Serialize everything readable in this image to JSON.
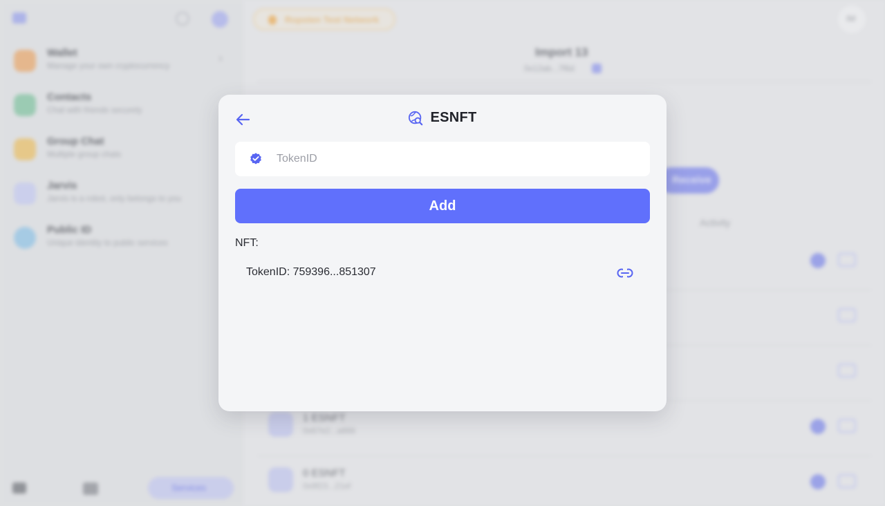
{
  "background": {
    "sidebar": {
      "items": [
        {
          "title": "Wallet",
          "subtitle": "Manage your own cryptocurrency",
          "color": "#f0a866"
        },
        {
          "title": "Contacts",
          "subtitle": "Chat with friends securely",
          "color": "#7fc6a0"
        },
        {
          "title": "Group Chat",
          "subtitle": "Multiple group chats",
          "color": "#f1c260"
        },
        {
          "title": "Jarvis",
          "subtitle": "Jarvis is a robot, only belongs to you",
          "color": "#c8cdf7"
        },
        {
          "title": "Public ID",
          "subtitle": "Unique identity to public services",
          "color": "#8fc6ec"
        }
      ],
      "bottom_button": "Services"
    },
    "network_badge": "Ropsten Test Network",
    "avatar_initials": "IM",
    "account": {
      "title": "Import 13",
      "address": "0x12ab...7f6d"
    },
    "receive_label": "Receive",
    "activity_label": "Activity",
    "rows": [
      {
        "name": "1 ESNFT",
        "sub": "0x67e2...a866"
      },
      {
        "name": "0 ESNFT",
        "sub": "0x9f23...21ef"
      }
    ]
  },
  "modal": {
    "title": "ESNFT",
    "back_icon": "arrow-left-icon",
    "title_icon": "globe-search-icon",
    "input": {
      "placeholder": "TokenID",
      "value": "",
      "icon": "verified-badge-icon"
    },
    "add_button": "Add",
    "nft_label": "NFT:",
    "nft_items": [
      {
        "token": "TokenID: 759396...851307",
        "icon": "link-icon"
      }
    ]
  },
  "colors": {
    "accent": "#6070fc",
    "modal_bg": "#f4f5f7",
    "icon": "#5865f2"
  }
}
